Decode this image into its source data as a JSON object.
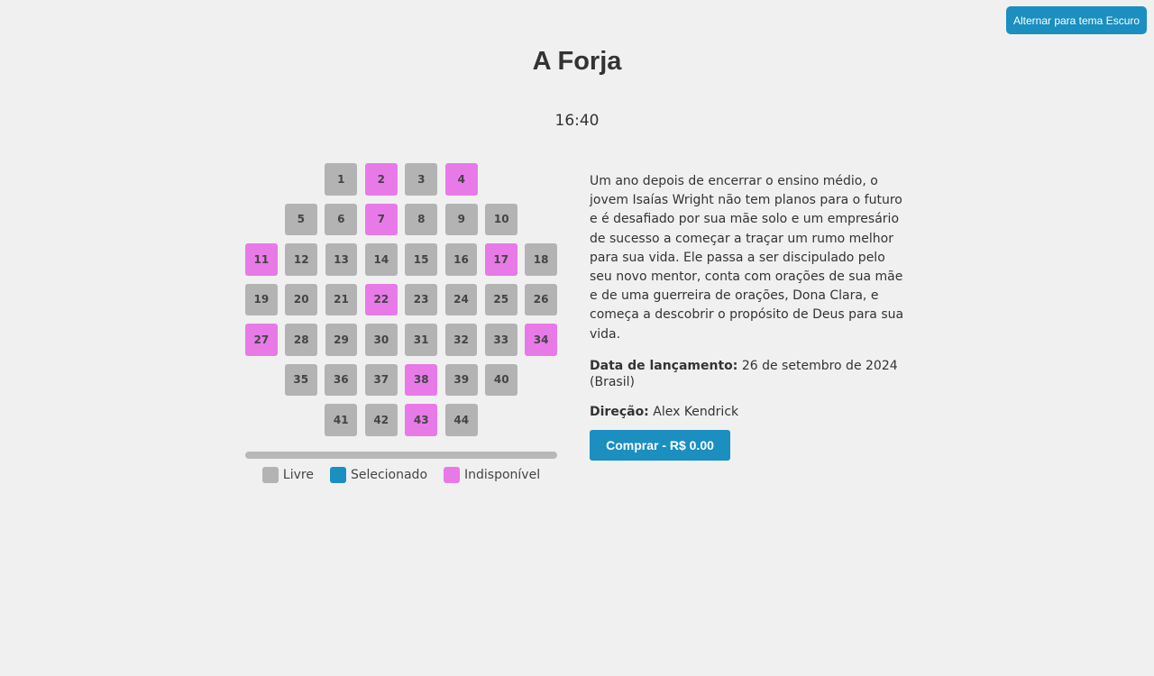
{
  "theme_toggle": {
    "label": "Alternar para tema Escuro"
  },
  "movie": {
    "title": "A Forja",
    "time": "16:40",
    "synopsis": "Um ano depois de encerrar o ensino médio, o jovem Isaías Wright não tem planos para o futuro e é desafiado por sua mãe solo e um empresário de sucesso a começar a traçar um rumo melhor para sua vida. Ele passa a ser discipulado pelo seu novo mentor, conta com orações de sua mãe e de uma guerreira de orações, Dona Clara, e começa a descobrir o propósito de Deus para sua vida.",
    "release_label": "Data de lançamento:",
    "release_value": "26 de setembro de 2024 (Brasil)",
    "director_label": "Direção:",
    "director_value": "Alex Kendrick"
  },
  "seats": {
    "rows": [
      [
        {
          "n": "1",
          "s": "free"
        },
        {
          "n": "2",
          "s": "unavailable"
        },
        {
          "n": "3",
          "s": "free"
        },
        {
          "n": "4",
          "s": "unavailable"
        }
      ],
      [
        {
          "n": "5",
          "s": "free"
        },
        {
          "n": "6",
          "s": "free"
        },
        {
          "n": "7",
          "s": "unavailable"
        },
        {
          "n": "8",
          "s": "free"
        },
        {
          "n": "9",
          "s": "free"
        },
        {
          "n": "10",
          "s": "free"
        }
      ],
      [
        {
          "n": "11",
          "s": "unavailable"
        },
        {
          "n": "12",
          "s": "free"
        },
        {
          "n": "13",
          "s": "free"
        },
        {
          "n": "14",
          "s": "free"
        },
        {
          "n": "15",
          "s": "free"
        },
        {
          "n": "16",
          "s": "free"
        },
        {
          "n": "17",
          "s": "unavailable"
        },
        {
          "n": "18",
          "s": "free"
        }
      ],
      [
        {
          "n": "19",
          "s": "free"
        },
        {
          "n": "20",
          "s": "free"
        },
        {
          "n": "21",
          "s": "free"
        },
        {
          "n": "22",
          "s": "unavailable"
        },
        {
          "n": "23",
          "s": "free"
        },
        {
          "n": "24",
          "s": "free"
        },
        {
          "n": "25",
          "s": "free"
        },
        {
          "n": "26",
          "s": "free"
        }
      ],
      [
        {
          "n": "27",
          "s": "unavailable"
        },
        {
          "n": "28",
          "s": "free"
        },
        {
          "n": "29",
          "s": "free"
        },
        {
          "n": "30",
          "s": "free"
        },
        {
          "n": "31",
          "s": "free"
        },
        {
          "n": "32",
          "s": "free"
        },
        {
          "n": "33",
          "s": "free"
        },
        {
          "n": "34",
          "s": "unavailable"
        }
      ],
      [
        {
          "n": "35",
          "s": "free"
        },
        {
          "n": "36",
          "s": "free"
        },
        {
          "n": "37",
          "s": "free"
        },
        {
          "n": "38",
          "s": "unavailable"
        },
        {
          "n": "39",
          "s": "free"
        },
        {
          "n": "40",
          "s": "free"
        }
      ],
      [
        {
          "n": "41",
          "s": "free"
        },
        {
          "n": "42",
          "s": "free"
        },
        {
          "n": "43",
          "s": "unavailable"
        },
        {
          "n": "44",
          "s": "free"
        }
      ]
    ]
  },
  "legend": {
    "free": "Livre",
    "selected": "Selecionado",
    "unavailable": "Indisponível"
  },
  "colors": {
    "free": "#b3b3b3",
    "selected": "#1a8fc0",
    "unavailable": "#e87ae8",
    "accent": "#1a8fc0"
  },
  "buy": {
    "label": "Comprar - R$ 0.00"
  }
}
